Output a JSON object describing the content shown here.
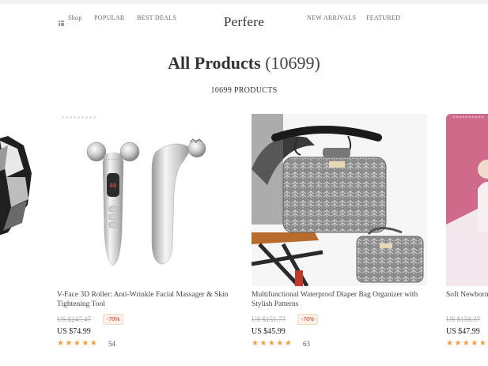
{
  "nav": {
    "shop_label": "Shop",
    "popular_label": "POPULAR",
    "best_deals_label": "BEST DEALS",
    "logo": "Perfere",
    "new_arrivals_label": "NEW ARRIVALS",
    "featured_label": "FEATURED"
  },
  "heading": {
    "title": "All Products",
    "count": "(10699)",
    "product_count": "10699 PRODUCTS"
  },
  "products": [
    {
      "title": "V-Face 3D Roller: Anti-Wrinkle Facial Massager & Skin Tightening Tool",
      "old_price": "US $247.47",
      "discount": "-70%",
      "price": "US $74.99",
      "stars": "★★★★★",
      "reviews": "54"
    },
    {
      "title": "Multifunctional Waterproof Diaper Bag Organizer with Stylish Patterns",
      "old_price": "US $151.77",
      "discount": "-70%",
      "price": "US $45.99",
      "stars": "★★★★★",
      "reviews": "63"
    },
    {
      "title": "Soft Newborn Baby Bath Support Net with Foldable Tub",
      "old_price": "US $158.37",
      "price": "US $47.99",
      "stars": "★★★★★"
    }
  ]
}
